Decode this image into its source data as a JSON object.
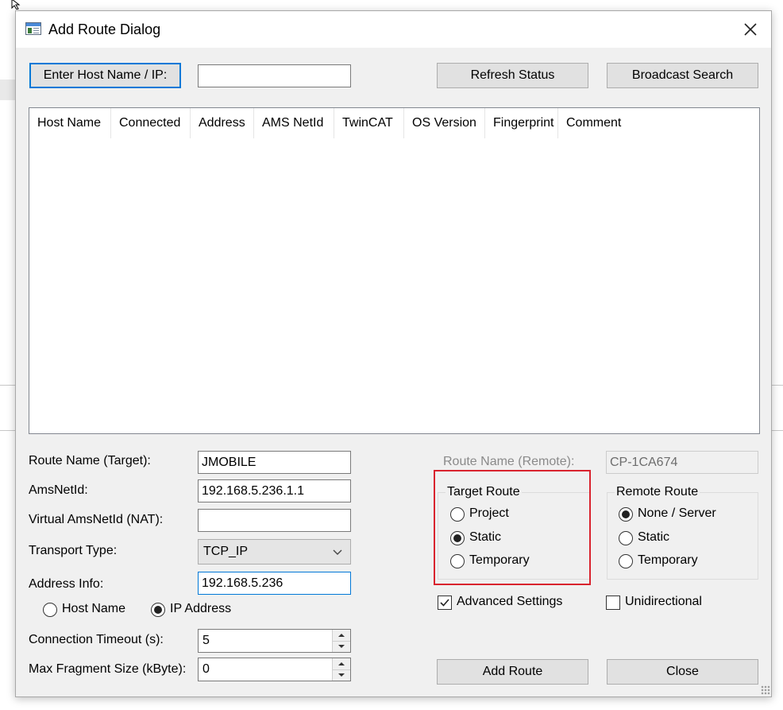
{
  "window": {
    "title": "Add Route Dialog"
  },
  "toolbar": {
    "enter_host_label": "Enter Host Name / IP:",
    "host_input_value": "",
    "refresh_label": "Refresh Status",
    "broadcast_label": "Broadcast Search"
  },
  "table": {
    "columns": [
      "Host Name",
      "Connected",
      "Address",
      "AMS NetId",
      "TwinCAT",
      "OS Version",
      "Fingerprint",
      "Comment"
    ],
    "rows": []
  },
  "form": {
    "route_name_label": "Route Name (Target):",
    "route_name_value": "JMOBILE",
    "amsnetid_label": "AmsNetId:",
    "amsnetid_value": "192.168.5.236.1.1",
    "virtual_label": "Virtual AmsNetId (NAT):",
    "virtual_value": "",
    "transport_label": "Transport Type:",
    "transport_value": "TCP_IP",
    "address_label": "Address Info:",
    "address_value": "192.168.5.236",
    "host_name_option": "Host Name",
    "ip_address_option": "IP Address",
    "address_mode": "IP Address",
    "timeout_label": "Connection Timeout (s):",
    "timeout_value": "5",
    "fragment_label": "Max Fragment Size (kByte):",
    "fragment_value": "0"
  },
  "remote": {
    "route_name_label": "Route Name (Remote):",
    "route_name_value": "CP-1CA674"
  },
  "target_route": {
    "title": "Target Route",
    "options": [
      "Project",
      "Static",
      "Temporary"
    ],
    "selected": "Static"
  },
  "remote_route": {
    "title": "Remote Route",
    "options": [
      "None / Server",
      "Static",
      "Temporary"
    ],
    "selected": "None / Server"
  },
  "options": {
    "advanced_label": "Advanced Settings",
    "advanced_checked": true,
    "unidirectional_label": "Unidirectional",
    "unidirectional_checked": false
  },
  "actions": {
    "add_route_label": "Add Route",
    "close_label": "Close"
  },
  "colors": {
    "highlight": "#d9232e",
    "focus": "#0078d7"
  }
}
